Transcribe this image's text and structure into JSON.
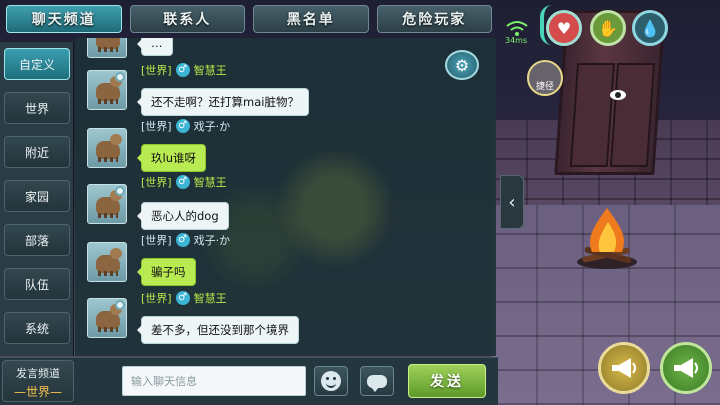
{
  "tabs": [
    {
      "label": "聊天频道",
      "active": true
    },
    {
      "label": "联系人",
      "active": false
    },
    {
      "label": "黑名单",
      "active": false
    },
    {
      "label": "危险玩家",
      "active": false
    }
  ],
  "channels": [
    {
      "label": "自定义",
      "active": true
    },
    {
      "label": "世界",
      "active": false
    },
    {
      "label": "附近",
      "active": false
    },
    {
      "label": "家园",
      "active": false
    },
    {
      "label": "部落",
      "active": false
    },
    {
      "label": "队伍",
      "active": false
    },
    {
      "label": "系统",
      "active": false
    }
  ],
  "messages": [
    {
      "channel": "[世界]",
      "name": "智慧王",
      "text": "…",
      "bubble": "white"
    },
    {
      "channel": "[世界]",
      "name": "戏子·か",
      "text": "还不走啊？还打算mai脏物？",
      "bubble": "white"
    },
    {
      "channel": "[世界]",
      "name": "智慧王",
      "text": "玖lu谁呀",
      "bubble": "green"
    },
    {
      "channel": "[世界]",
      "name": "戏子·か",
      "text": "恶心人的dog",
      "bubble": "white"
    },
    {
      "channel": "[世界]",
      "name": "智慧王",
      "text": "骗子吗",
      "bubble": "green"
    },
    {
      "channel": "",
      "name": "",
      "text": "差不多，但还没到那个境界",
      "bubble": "white"
    }
  ],
  "bottom": {
    "speak_channel_label": "发言频道",
    "speak_channel_value": "—世界—",
    "input_placeholder": "输入聊天信息",
    "send_label": "发送"
  },
  "hud": {
    "ping": "34ms",
    "emote_label": "捷径"
  },
  "colors": {
    "accent": "#3e9fae",
    "green_bubble": "#b8ea52",
    "name_green": "#b8e64a"
  },
  "icons": [
    "settings-icon",
    "chevron-left-icon",
    "emoji-icon",
    "speech-bubble-icon",
    "heart-icon",
    "hand-icon",
    "water-drop-icon",
    "eye-icon",
    "megaphone-icon",
    "wifi-icon"
  ]
}
